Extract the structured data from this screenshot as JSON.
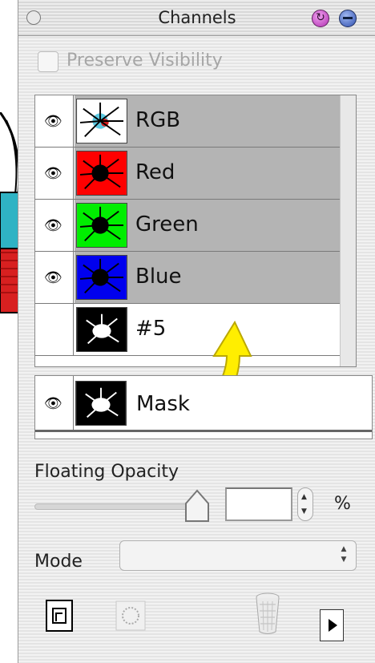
{
  "window": {
    "title": "Channels"
  },
  "preserve_visibility": {
    "label": "Preserve Visibility",
    "checked": false,
    "enabled": false
  },
  "channels": [
    {
      "name": "RGB",
      "visible": true,
      "selected": true,
      "thumb_color": "#ffffff"
    },
    {
      "name": "Red",
      "visible": true,
      "selected": true,
      "thumb_color": "#ff0000"
    },
    {
      "name": "Green",
      "visible": true,
      "selected": true,
      "thumb_color": "#00ee00"
    },
    {
      "name": "Blue",
      "visible": true,
      "selected": true,
      "thumb_color": "#0000ee"
    },
    {
      "name": "#5",
      "visible": false,
      "selected": false,
      "thumb_color": "#000000"
    }
  ],
  "mask": {
    "name": "Mask",
    "visible": true
  },
  "floating_opacity": {
    "label": "Floating Opacity",
    "value": "",
    "unit": "%"
  },
  "mode": {
    "label": "Mode",
    "value": ""
  },
  "icons": {
    "eye": "eye-icon",
    "new_channel": "new-channel-icon",
    "save_selection": "save-selection-icon",
    "trash": "trash-icon",
    "menu": "panel-menu-icon",
    "arrow": "yellow-arrow"
  },
  "colors": {
    "selected_row": "#b4b4b4",
    "arrow": "#ffee00"
  }
}
